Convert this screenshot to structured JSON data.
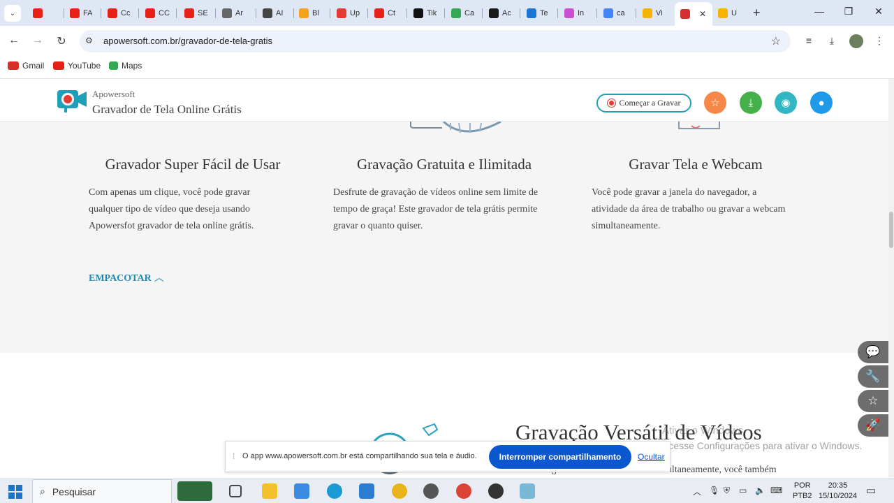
{
  "browser": {
    "tabs": [
      {
        "label": "",
        "color": "#e62117"
      },
      {
        "label": "FA",
        "color": "#e62117"
      },
      {
        "label": "Cc",
        "color": "#e62117"
      },
      {
        "label": "CC",
        "color": "#e62117"
      },
      {
        "label": "SE",
        "color": "#e62117"
      },
      {
        "label": "Ar",
        "color": "#666666"
      },
      {
        "label": "AI",
        "color": "#444444"
      },
      {
        "label": "Bl",
        "color": "#f4a21a"
      },
      {
        "label": "Up",
        "color": "#e53935"
      },
      {
        "label": "Ct",
        "color": "#e62117"
      },
      {
        "label": "Tik",
        "color": "#111111"
      },
      {
        "label": "Ca",
        "color": "#34a853"
      },
      {
        "label": "Ac",
        "color": "#1a1a1a"
      },
      {
        "label": "Te",
        "color": "#1976d2"
      },
      {
        "label": "In",
        "color": "#c94fd0"
      },
      {
        "label": "ca",
        "color": "#4285f4"
      },
      {
        "label": "Vi",
        "color": "#f4b400"
      },
      {
        "label": "",
        "color": "#d32f2f"
      },
      {
        "label": "U",
        "color": "#f4b400"
      }
    ],
    "active_tab_close": "✕",
    "new_tab": "+",
    "url": "apowersoft.com.br/gravador-de-tela-gratis",
    "bookmarks": [
      {
        "label": "Gmail",
        "color": "#d93025"
      },
      {
        "label": "YouTube",
        "color": "#e62117"
      },
      {
        "label": "Maps",
        "color": "#34a853"
      }
    ]
  },
  "site": {
    "brand_small": "Apowersoft",
    "brand_big": "Gravador de Tela Online Grátis",
    "record_button": "Começar a Gravar",
    "colors": {
      "accent": "#20a0b8",
      "orange": "#f7884a",
      "green": "#46b04a",
      "teal": "#31b6c4",
      "blue": "#1e9ae8"
    }
  },
  "features": [
    {
      "title": "Gravador Super Fácil de Usar",
      "lines": [
        "Com apenas um clique, você pode gravar",
        "qualquer tipo de vídeo que deseja usando",
        "Apowersfot gravador de tela online grátis."
      ]
    },
    {
      "title": "Gravação Gratuita e Ilimitada",
      "lines": [
        "Desfrute de gravação de vídeos online sem limite de",
        "tempo de graça! Este gravador de tela grátis permite",
        "gravar o quanto quiser."
      ]
    },
    {
      "title": "Gravar Tela e Webcam",
      "lines": [
        "Você pode gravar a janela do navegador, a",
        "atividade da área de trabalho ou gravar a webcam",
        "simultaneamente."
      ]
    }
  ],
  "collapse_label": "EMPACOTAR",
  "section": {
    "title": "Gravação Versátil de Vídeos",
    "text": "Além de gravar a tela com o áudio simultaneamente, você também"
  },
  "watermark": {
    "line1": "Ativar o Windows",
    "line2": "Acesse Configurações para ativar o Windows."
  },
  "share_bar": {
    "message": "O app www.apowersoft.com.br está compartilhando sua tela e áudio.",
    "stop_button": "Interromper compartilhamento",
    "hide_link": "Ocultar"
  },
  "taskbar": {
    "search_placeholder": "Pesquisar",
    "lang_line1": "POR",
    "lang_line2": "PTB2",
    "time": "20:35",
    "date": "15/10/2024"
  }
}
